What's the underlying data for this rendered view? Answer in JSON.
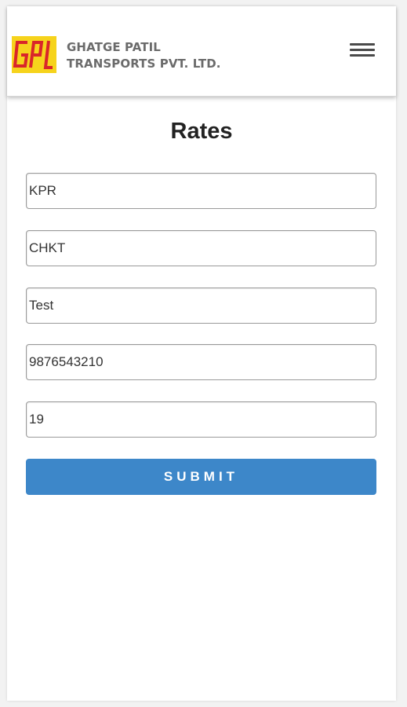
{
  "header": {
    "company_line1": "GHATGE PATIL",
    "company_line2": "TRANSPORTS PVT. LTD.",
    "logo_text": "GPL",
    "menu_icon": "hamburger-icon"
  },
  "page": {
    "title": "Rates"
  },
  "form": {
    "fields": [
      {
        "value": "KPR"
      },
      {
        "value": "CHKT"
      },
      {
        "value": "Test"
      },
      {
        "value": "9876543210"
      },
      {
        "value": "19"
      }
    ],
    "submit_label": "SUBMIT"
  },
  "colors": {
    "accent": "#3d87c9",
    "logo_yellow": "#f6d31c",
    "logo_red": "#d9252a"
  }
}
